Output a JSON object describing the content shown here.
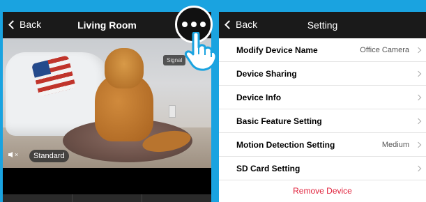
{
  "left": {
    "back_label": "Back",
    "title": "Living Room",
    "signal_label": "Signal",
    "quality_label": "Standard",
    "mute_icon": "speaker-mute-icon",
    "more_icon": "more-dots-icon"
  },
  "right": {
    "back_label": "Back",
    "title": "Setting",
    "items": [
      {
        "label": "Modify Device Name",
        "value": "Office Camera"
      },
      {
        "label": "Device Sharing",
        "value": ""
      },
      {
        "label": "Device Info",
        "value": ""
      },
      {
        "label": "Basic Feature Setting",
        "value": ""
      },
      {
        "label": "Motion Detection Setting",
        "value": "Medium"
      },
      {
        "label": "SD Card Setting",
        "value": ""
      }
    ],
    "remove_label": "Remove Device"
  },
  "colors": {
    "background": "#1aa3e0",
    "header": "#1a1a1a",
    "remove": "#e0203a"
  }
}
